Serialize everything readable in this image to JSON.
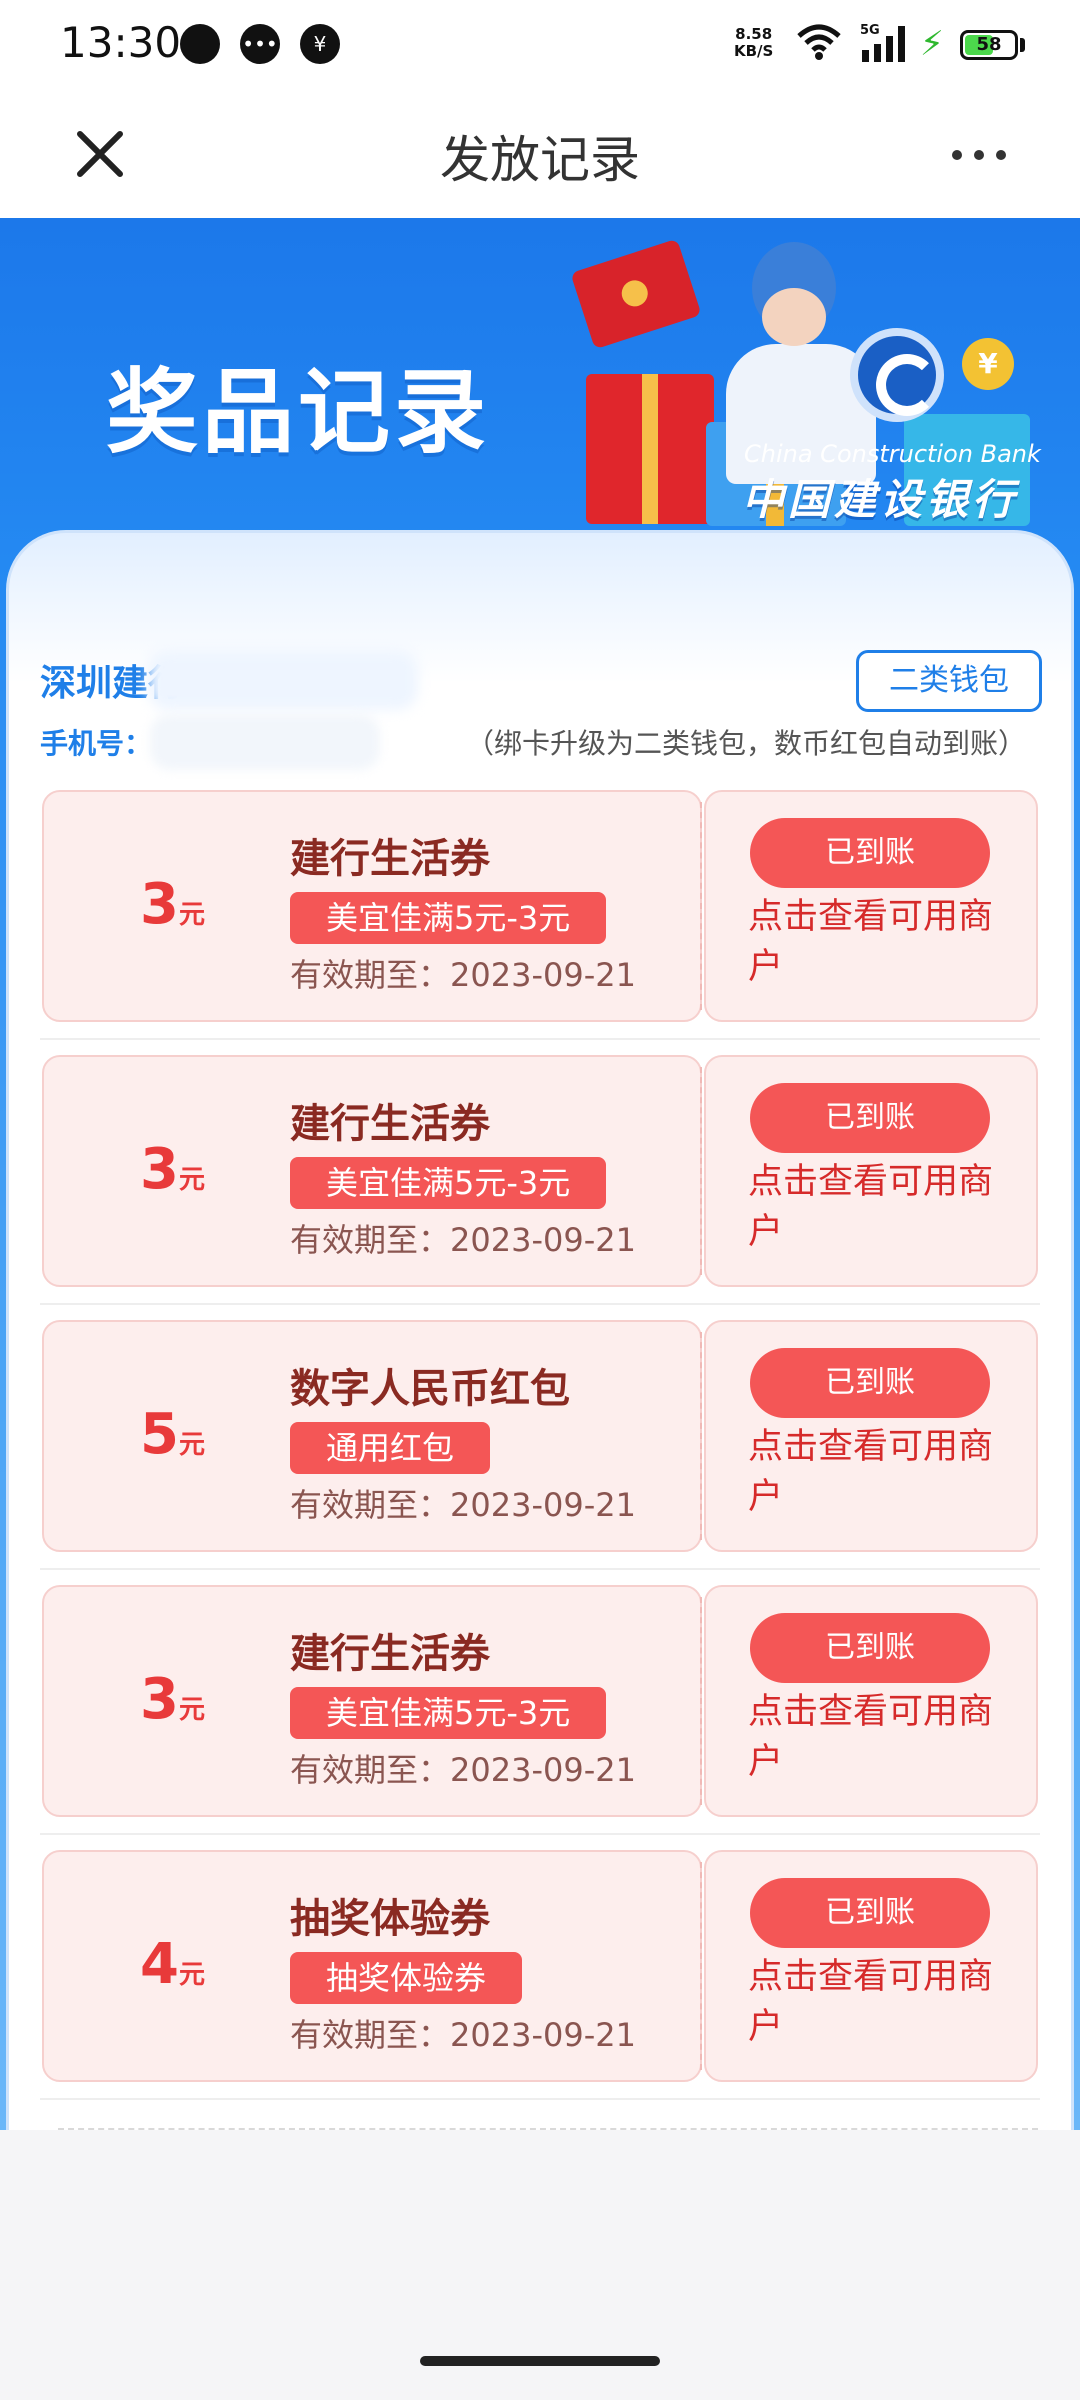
{
  "status_bar": {
    "time": "13:30",
    "network_speed_value": "8.58",
    "network_speed_unit": "KB/S",
    "signal_type": "5G",
    "battery": "58",
    "battery_level": 0.58,
    "icons": [
      "chat-bubble-icon",
      "message-dots-icon",
      "yuan-shield-icon",
      "wifi-icon",
      "signal-icon",
      "charging-bolt-icon",
      "battery-icon"
    ]
  },
  "nav": {
    "title": "发放记录",
    "close_icon": "close-icon",
    "more_icon": "more-dots-icon"
  },
  "banner": {
    "title": "奖品记录",
    "bank_name_en": "China Construction Bank",
    "bank_name_cn": "中国建设银行"
  },
  "account": {
    "name": "深圳建行",
    "phone_label": "手机号：",
    "wallet_button": "二类钱包",
    "wallet_note": "（绑卡升级为二类钱包，数币红包自动到账）"
  },
  "coupons": [
    {
      "amount": "3",
      "unit": "元",
      "title": "建行生活券",
      "tag": "美宜佳满5元-3元",
      "expiry": "有效期至：2023-09-21",
      "status": "已到账",
      "action": "点击查看可用商户"
    },
    {
      "amount": "3",
      "unit": "元",
      "title": "建行生活券",
      "tag": "美宜佳满5元-3元",
      "expiry": "有效期至：2023-09-21",
      "status": "已到账",
      "action": "点击查看可用商户"
    },
    {
      "amount": "5",
      "unit": "元",
      "title": "数字人民币红包",
      "tag": "通用红包",
      "expiry": "有效期至：2023-09-21",
      "status": "已到账",
      "action": "点击查看可用商户"
    },
    {
      "amount": "3",
      "unit": "元",
      "title": "建行生活券",
      "tag": "美宜佳满5元-3元",
      "expiry": "有效期至：2023-09-21",
      "status": "已到账",
      "action": "点击查看可用商户"
    },
    {
      "amount": "4",
      "unit": "元",
      "title": "抽奖体验券",
      "tag": "抽奖体验券",
      "expiry": "有效期至：2023-09-21",
      "status": "已到账",
      "action": "点击查看可用商户"
    }
  ],
  "colors": {
    "primary_blue": "#1f7fe8",
    "coupon_red": "#f45656",
    "coupon_bg": "#fdeeed"
  }
}
